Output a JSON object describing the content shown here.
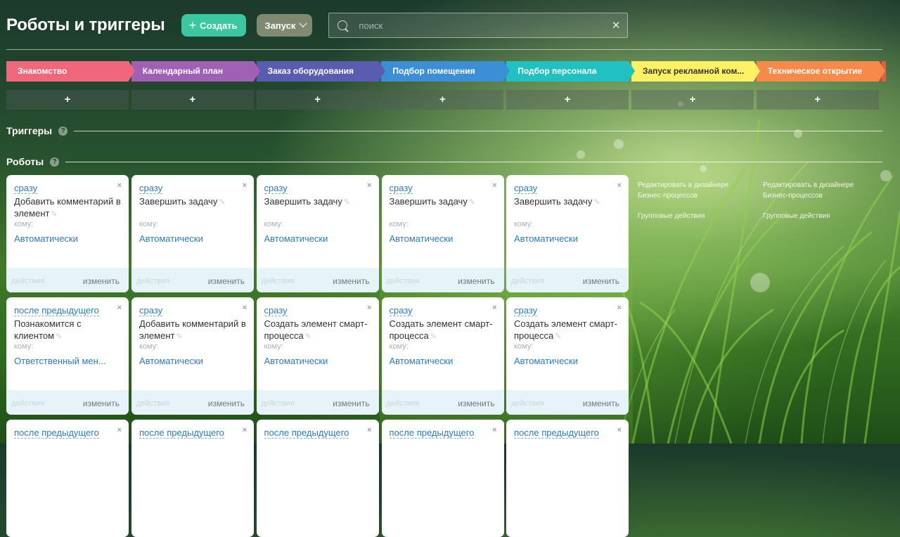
{
  "header": {
    "title": "Роботы и триггеры",
    "create_label": "Создать",
    "launch_label": "Запуск",
    "search_placeholder": "поиск"
  },
  "stages": [
    {
      "label": "Знакомство",
      "color": "#f0667a"
    },
    {
      "label": "Календарный план",
      "color": "#a060b6"
    },
    {
      "label": "Заказ оборудования",
      "color": "#5a5cb0"
    },
    {
      "label": "Подбор помещения",
      "color": "#3c8fd6"
    },
    {
      "label": "Подбор персонала",
      "color": "#22c1c1"
    },
    {
      "label": "Запуск рекламной ком...",
      "color": "#fff163"
    },
    {
      "label": "Техническое открытие",
      "color": "#f78a4b"
    }
  ],
  "add_symbol": "+",
  "sections": {
    "triggers": "Триггеры",
    "robots": "Роботы",
    "help": "?"
  },
  "card_common": {
    "to_label": "кому:",
    "actions_label": "действия",
    "edit_label": "изменить",
    "close": "×",
    "pencil": "✎"
  },
  "robot_rows": [
    [
      {
        "when": "сразу",
        "name": "Добавить комментарий в элемент",
        "to": "Автоматически"
      },
      {
        "when": "сразу",
        "name": "Завершить задачу",
        "to": "Автоматически"
      },
      {
        "when": "сразу",
        "name": "Завершить задачу",
        "to": "Автоматически"
      },
      {
        "when": "сразу",
        "name": "Завершить задачу",
        "to": "Автоматически"
      },
      {
        "when": "сразу",
        "name": "Завершить задачу",
        "to": "Автоматически"
      }
    ],
    [
      {
        "when": "после предыдущего",
        "name": "Познакомится с клиентом",
        "to": "Ответственный мен..."
      },
      {
        "when": "сразу",
        "name": "Добавить комментарий в элемент",
        "to": "Автоматически"
      },
      {
        "when": "сразу",
        "name": "Создать элемент смарт-процесса",
        "to": "Автоматически"
      },
      {
        "when": "сразу",
        "name": "Создать элемент смарт-процесса",
        "to": "Автоматически"
      },
      {
        "when": "сразу",
        "name": "Создать элемент смарт-процесса",
        "to": "Автоматически"
      }
    ],
    [
      {
        "when": "после предыдущего"
      },
      {
        "when": "после предыдущего"
      },
      {
        "when": "после предыдущего"
      },
      {
        "when": "после предыдущего"
      },
      {
        "when": "после предыдущего"
      }
    ]
  ],
  "side_links": [
    {
      "edit": "Редактировать в дизайнере Бизнес-процессов",
      "group": "Групповые действия"
    },
    {
      "edit": "Редактировать в дизайнере Бизнес-процессов",
      "group": "Групповые действия"
    }
  ]
}
